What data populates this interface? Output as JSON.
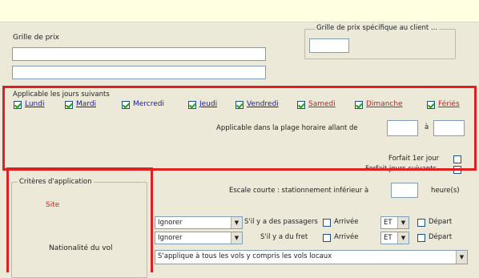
{
  "grille": {
    "label": "Grille de prix",
    "specific_label": "Grille de prix spécifique au client ..."
  },
  "applicable": {
    "title": "Applicable les jours suivants",
    "days": [
      {
        "label": "Lundi",
        "checked": true,
        "color": "blue"
      },
      {
        "label": "Mardi",
        "checked": true,
        "color": "blue"
      },
      {
        "label": "Mercredi",
        "checked": true,
        "color": "blue"
      },
      {
        "label": "Jeudi",
        "checked": true,
        "color": "blue"
      },
      {
        "label": "Vendredi",
        "checked": true,
        "color": "blue"
      },
      {
        "label": "Samedi",
        "checked": true,
        "color": "red"
      },
      {
        "label": "Dimanche",
        "checked": true,
        "color": "red"
      },
      {
        "label": "Fériés",
        "checked": true,
        "color": "red"
      }
    ],
    "time_range_label": "Applicable  dans la plage horaire allant de",
    "to_label": "à"
  },
  "forfait": {
    "first_day_label": "Forfait 1er jour",
    "next_days_label": "Forfait jours suivants"
  },
  "escale": {
    "label": "Escale courte : stationnement  inférieur à",
    "unit": "heure(s)"
  },
  "criteres": {
    "title": "Critères d'application",
    "site_label": "Site",
    "nationalite_label": "Nationalité du vol"
  },
  "rules": {
    "row1": {
      "select": "Ignorer",
      "condition": "S'il y a des passagers",
      "arrivee": "Arrivée",
      "op": "ET",
      "depart": "Départ"
    },
    "row2": {
      "select": "Ignorer",
      "condition": "S'il y a du fret",
      "arrivee": "Arrivée",
      "op": "ET",
      "depart": "Départ"
    },
    "scope_select": "S'applique à tous les vols y compris les vols locaux"
  },
  "colors": {
    "highlight": "#e02020",
    "checkmark": "#21a121",
    "day_blue": "#1a1aa8",
    "day_red": "#c81e1e"
  }
}
